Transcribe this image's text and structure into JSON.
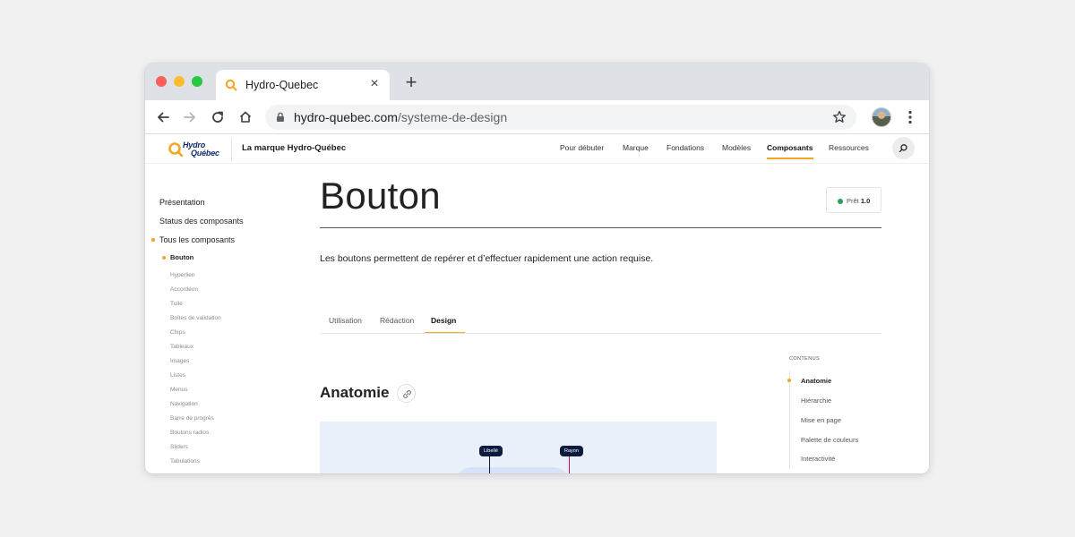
{
  "browser": {
    "tab_title": "Hydro-Quebec",
    "tab_close": "×",
    "new_tab": "+",
    "url_host": "hydro-quebec.com",
    "url_path": "/systeme-de-design"
  },
  "header": {
    "logo_line1": "Hydro",
    "logo_line2": "Québec",
    "brand": "La marque Hydro-Québec",
    "nav": [
      "Pour débuter",
      "Marque",
      "Fondations",
      "Modèles",
      "Composants",
      "Ressources"
    ],
    "active_nav": "Composants"
  },
  "sidebar": {
    "items": [
      "Présentation",
      "Status des composants",
      "Tous les composants"
    ],
    "active_sub": "Bouton",
    "subitems": [
      "Hyperlien",
      "Accordéon",
      "Tuile",
      "Boîtes de validation",
      "Chips",
      "Tableaux",
      "Images",
      "Listes",
      "Menus",
      "Navigation",
      "Barre de progrès",
      "Boutons radios",
      "Sliders",
      "Tabulations"
    ]
  },
  "main": {
    "title": "Bouton",
    "status_label": "Prêt",
    "status_version": "1.0",
    "lead": "Les boutons permettent de repérer et d’effectuer rapidement une action requise.",
    "tabs": [
      "Utilisation",
      "Rédaction",
      "Design"
    ],
    "active_tab": "Design",
    "section_title": "Anatomie",
    "demo_tags": [
      "Libellé",
      "Rayon"
    ]
  },
  "toc": {
    "heading": "CONTENUS",
    "items": [
      "Anatomie",
      "Hiérarchie",
      "Mise en page",
      "Palette de couleurs",
      "Interactivité"
    ],
    "active": "Anatomie"
  },
  "colors": {
    "accent": "#f5a623",
    "brand_navy": "#0d2c6c",
    "status_green": "#2e9e5b",
    "demo_bg": "#e9f0fa"
  }
}
